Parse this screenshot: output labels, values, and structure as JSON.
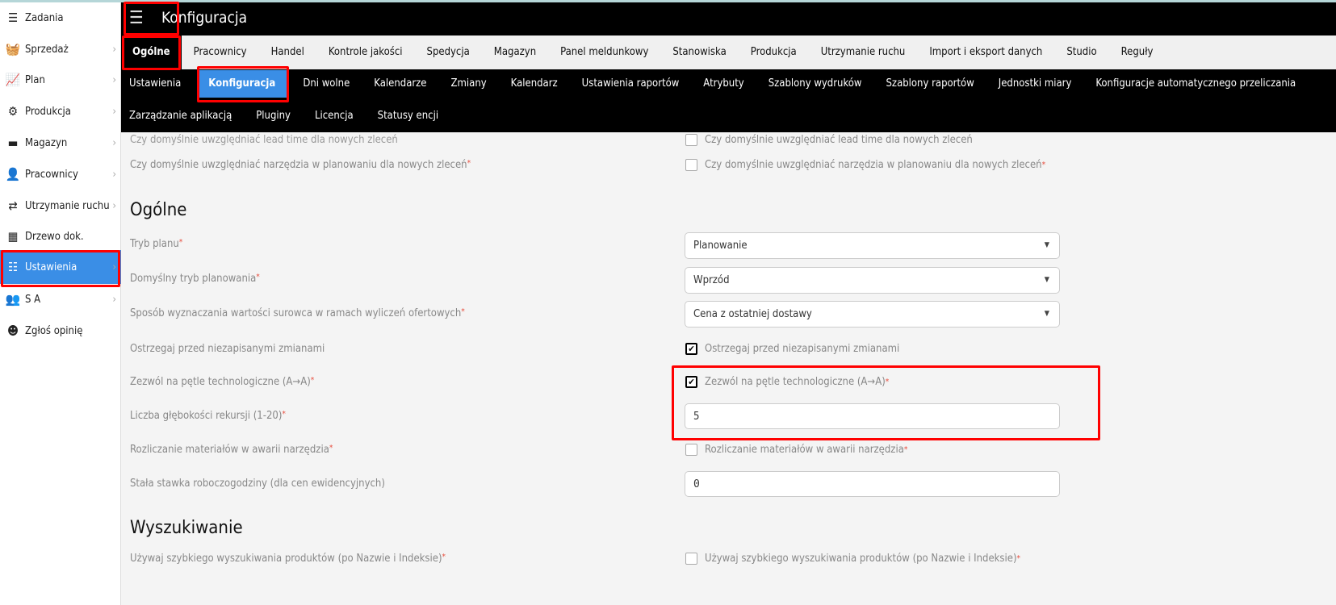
{
  "header": {
    "title": "Konfiguracja",
    "menu_icon": "hamburger-icon"
  },
  "sidebar": {
    "items": [
      {
        "label": "Zadania",
        "icon": "tasks-icon",
        "glyph": "☰",
        "chevron": false
      },
      {
        "label": "Sprzedaż",
        "icon": "basket-icon",
        "glyph": "🧺",
        "chevron": true
      },
      {
        "label": "Plan",
        "icon": "chart-line-icon",
        "glyph": "📈",
        "chevron": true
      },
      {
        "label": "Produkcja",
        "icon": "gears-icon",
        "glyph": "⚙",
        "chevron": true
      },
      {
        "label": "Magazyn",
        "icon": "archive-icon",
        "glyph": "▬",
        "chevron": true
      },
      {
        "label": "Pracownicy",
        "icon": "user-icon",
        "glyph": "👤",
        "chevron": true
      },
      {
        "label": "Utrzymanie ruchu",
        "icon": "repeat-icon",
        "glyph": "⇄",
        "chevron": true
      },
      {
        "label": "Drzewo dok.",
        "icon": "folder-tree-icon",
        "glyph": "▦",
        "chevron": false
      },
      {
        "label": "Ustawienia",
        "icon": "sliders-icon",
        "glyph": "☷",
        "chevron": true,
        "active": true
      },
      {
        "label": "S A",
        "icon": "users-icon",
        "glyph": "👥",
        "chevron": true
      },
      {
        "label": "Zgłoś opinię",
        "icon": "smile-icon",
        "glyph": "☻",
        "chevron": false
      }
    ]
  },
  "tabs_main": [
    "Ogólne",
    "Pracownicy",
    "Handel",
    "Kontrole jakości",
    "Spedycja",
    "Magazyn",
    "Panel meldunkowy",
    "Stanowiska",
    "Produkcja",
    "Utrzymanie ruchu",
    "Import i eksport danych",
    "Studio",
    "Reguły"
  ],
  "tabs_main_active": "Ogólne",
  "tabs_sub_row1": [
    "Ustawienia",
    "Konfiguracja",
    "Dni wolne",
    "Kalendarze",
    "Zmiany",
    "Kalendarz",
    "Ustawienia raportów",
    "Atrybuty",
    "Szablony wydruków",
    "Szablony raportów",
    "Jednostki miary",
    "Konfiguracje automatycznego przeliczania"
  ],
  "tabs_sub_row2": [
    "Zarządzanie aplikacją",
    "Pluginy",
    "Licencja",
    "Statusy encji"
  ],
  "tabs_sub_active": "Konfiguracja",
  "content": {
    "lead_time_label": "Czy domyślnie uwzględniać lead time dla nowych zleceń",
    "tools_label": "Czy domyślnie uwzględniać narzędzia w planowaniu dla nowych zleceń",
    "section_general": "Ogólne",
    "plan_mode_label": "Tryb planu",
    "plan_mode_value": "Planowanie",
    "default_planning_label": "Domyślny tryb planowania",
    "default_planning_value": "Wprzód",
    "raw_value_label": "Sposób wyznaczania wartości surowca w ramach wyliczeń ofertowych",
    "raw_value_value": "Cena z ostatniej dostawy",
    "warn_unsaved_label": "Ostrzegaj przed niezapisanymi zmianami",
    "warn_unsaved_checked": true,
    "loops_label": "Zezwól na pętle technologiczne (A→A)",
    "loops_checked": true,
    "recursion_label": "Liczba głębokości rekursji (1-20)",
    "recursion_value": "5",
    "tool_failure_label": "Rozliczanie materiałów w awarii narzędzia",
    "tool_failure_checked": false,
    "hourly_rate_label": "Stała stawka roboczogodziny (dla cen ewidencyjnych)",
    "hourly_rate_value": "0",
    "section_search": "Wyszukiwanie",
    "fast_search_label": "Używaj szybkiego wyszukiwania produktów (po Nazwie i Indeksie)",
    "fast_search_checked": false,
    "lead_time_checked": false,
    "tools_checked": false,
    "required_mark": "*"
  },
  "colors": {
    "accent": "#3a8ee6",
    "highlight": "#ff0000",
    "header": "#000000"
  }
}
